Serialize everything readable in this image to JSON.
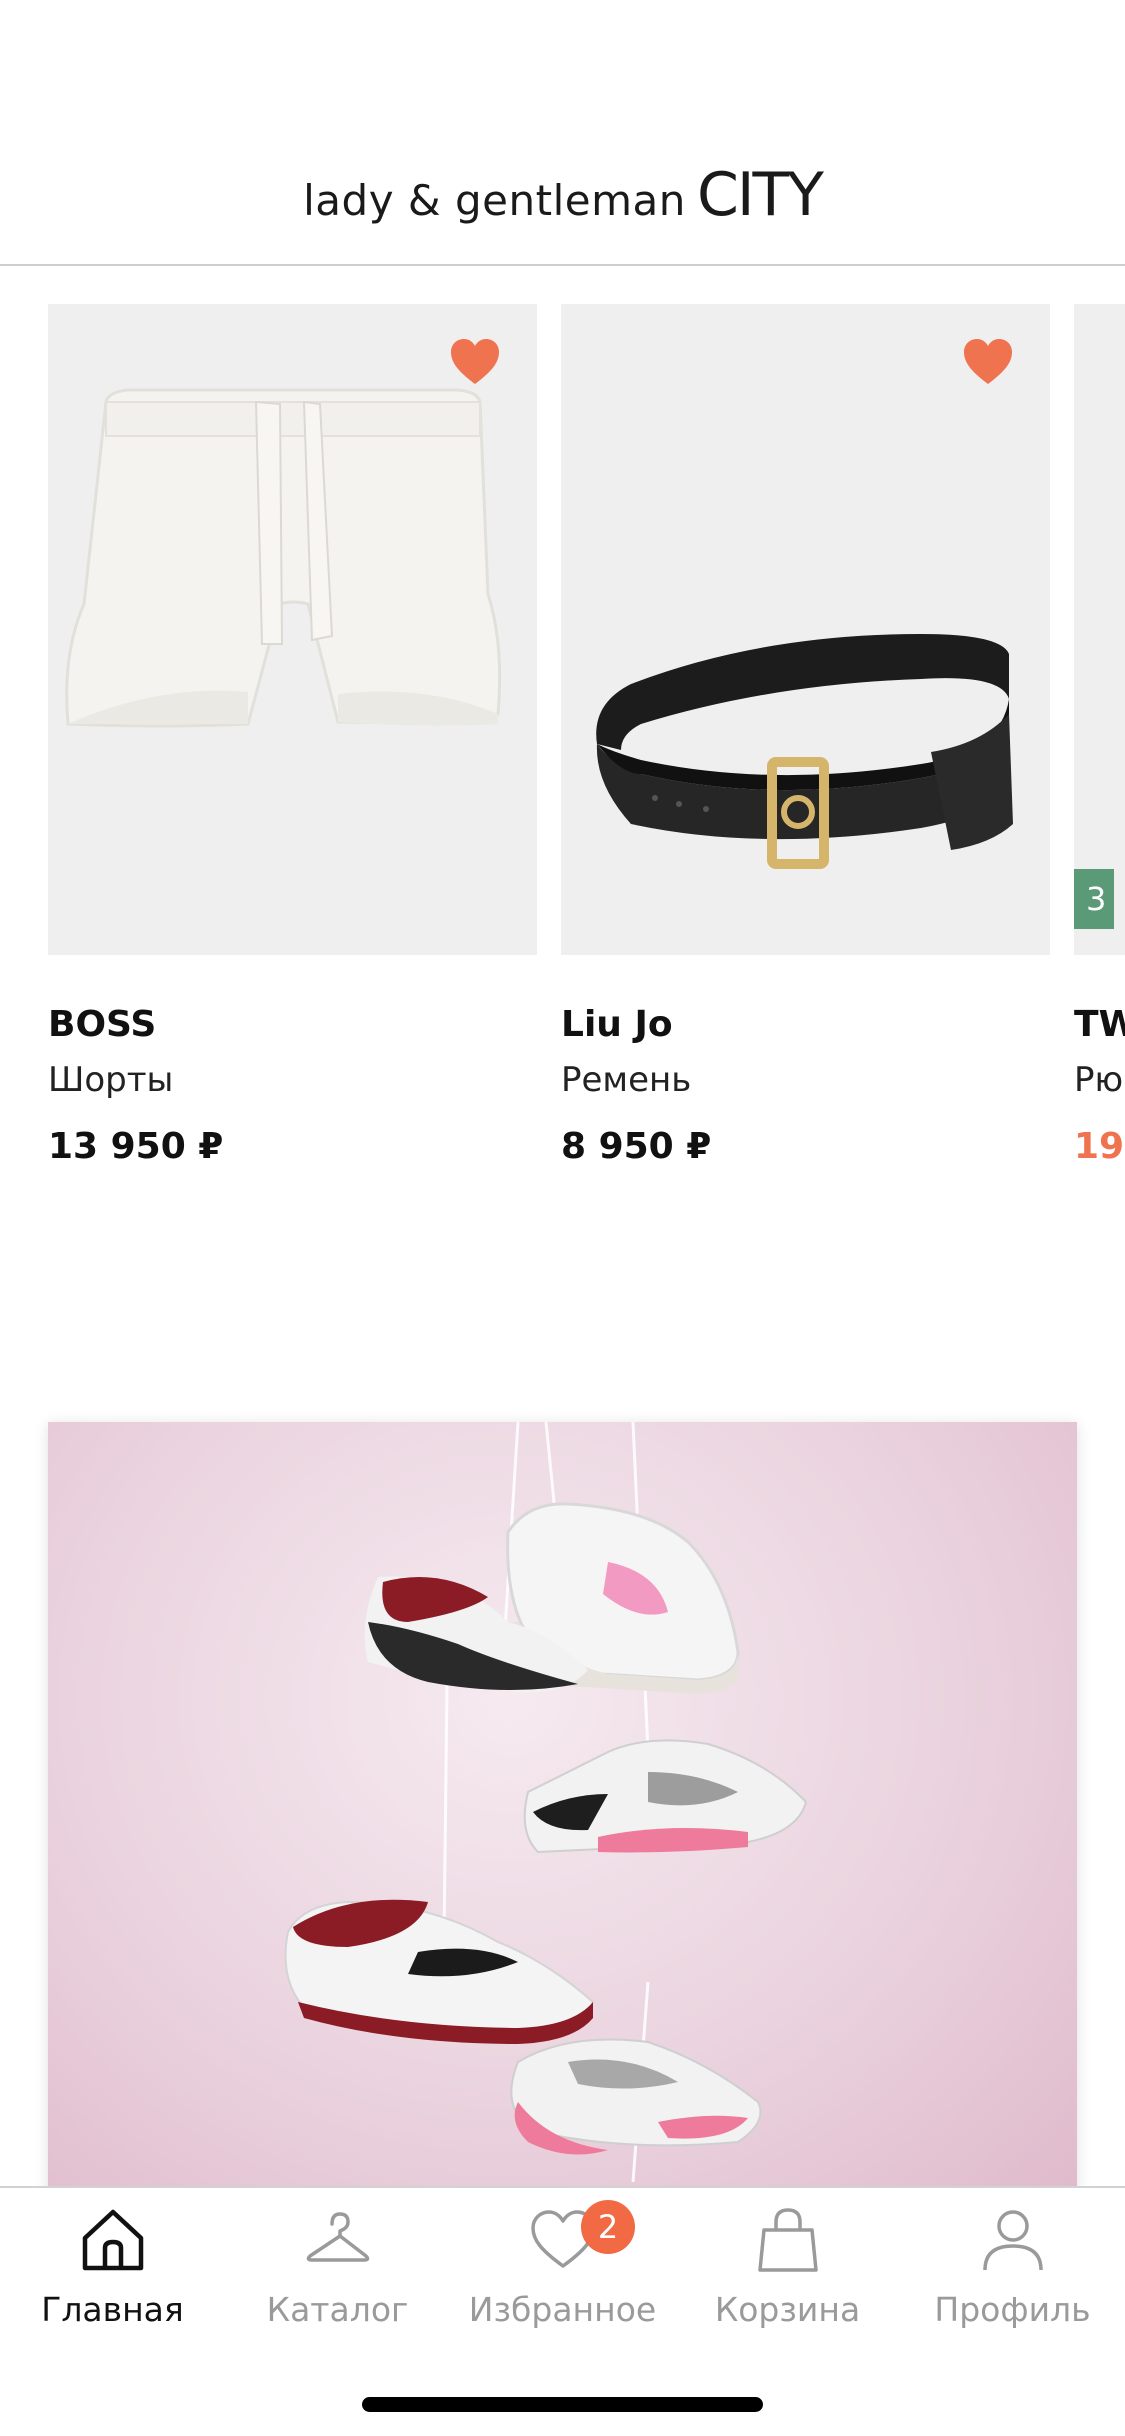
{
  "app": {
    "logo_small": "lady & gentleman",
    "logo_big": "CITY"
  },
  "products": [
    {
      "brand": "BOSS",
      "type": "Шорты",
      "price": "13 950 ₽",
      "favorited": true,
      "image": "white-shorts"
    },
    {
      "brand": "Liu Jo",
      "type": "Ремень",
      "price": "8 950 ₽",
      "favorited": true,
      "image": "black-belt"
    },
    {
      "brand": "TW",
      "type": "Рю",
      "price": "19",
      "badge": "3",
      "image": "green-product"
    }
  ],
  "banner": {
    "image": "hanging-sneakers"
  },
  "tabbar": {
    "tabs": [
      {
        "label": "Главная",
        "icon": "home-icon",
        "active": true
      },
      {
        "label": "Каталог",
        "icon": "hanger-icon",
        "active": false
      },
      {
        "label": "Избранное",
        "icon": "heart-icon",
        "active": false,
        "badge": "2"
      },
      {
        "label": "Корзина",
        "icon": "bag-icon",
        "active": false
      },
      {
        "label": "Профиль",
        "icon": "profile-icon",
        "active": false
      }
    ]
  },
  "colors": {
    "accent": "#f26a43",
    "heart": "#f07350",
    "sale_price": "#f07350",
    "badge_green": "#5a9a76"
  }
}
